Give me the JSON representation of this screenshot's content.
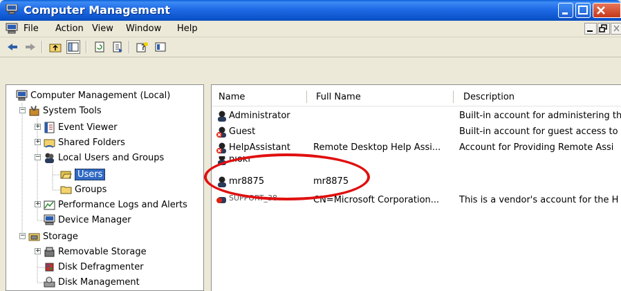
{
  "window": {
    "title": "Computer Management",
    "colors": {
      "titlebar": "#0a5fd6",
      "selection": "#316ac5",
      "highlight_ring": "#e01010"
    }
  },
  "menu": [
    "File",
    "Action",
    "View",
    "Window",
    "Help"
  ],
  "toolbar": {
    "icons": [
      "back-arrow-icon",
      "forward-arrow-icon",
      "up-folder-icon",
      "show-hide-tree-icon",
      "refresh-icon",
      "export-list-icon",
      "help-icon",
      "console-icon"
    ]
  },
  "tree": {
    "items": [
      {
        "label": "Computer Management (Local)",
        "icon": "computer-icon"
      },
      {
        "label": "System Tools",
        "icon": "tools-icon"
      },
      {
        "label": "Event Viewer",
        "icon": "event-viewer-icon"
      },
      {
        "label": "Shared Folders",
        "icon": "shared-folder-icon"
      },
      {
        "label": "Local Users and Groups",
        "icon": "users-groups-icon"
      },
      {
        "label": "Users",
        "icon": "folder-open-icon"
      },
      {
        "label": "Groups",
        "icon": "folder-icon"
      },
      {
        "label": "Performance Logs and Alerts",
        "icon": "performance-icon"
      },
      {
        "label": "Device Manager",
        "icon": "device-manager-icon"
      },
      {
        "label": "Storage",
        "icon": "storage-icon"
      },
      {
        "label": "Removable Storage",
        "icon": "removable-storage-icon"
      },
      {
        "label": "Disk Defragmenter",
        "icon": "defrag-icon"
      },
      {
        "label": "Disk Management",
        "icon": "disk-management-icon"
      }
    ]
  },
  "list": {
    "columns": [
      "Name",
      "Full Name",
      "Description"
    ],
    "rows": [
      {
        "name": "Administrator",
        "full_name": "",
        "description": "Built-in account for administering th",
        "disabled": false
      },
      {
        "name": "Guest",
        "full_name": "",
        "description": "Built-in account for guest access to",
        "disabled": true
      },
      {
        "name": "HelpAssistant",
        "full_name": "Remote Desktop Help Assi...",
        "description": "Account for Providing Remote Assi",
        "disabled": true
      },
      {
        "name": "nioki",
        "full_name": "",
        "description": "",
        "disabled": false
      },
      {
        "name": "mr8875",
        "full_name": "mr8875",
        "description": "",
        "disabled": false
      },
      {
        "name": "SUPPORT_38",
        "full_name": "CN=Microsoft Corporation...",
        "description": "This is a vendor's account for the H",
        "disabled": true
      }
    ]
  }
}
